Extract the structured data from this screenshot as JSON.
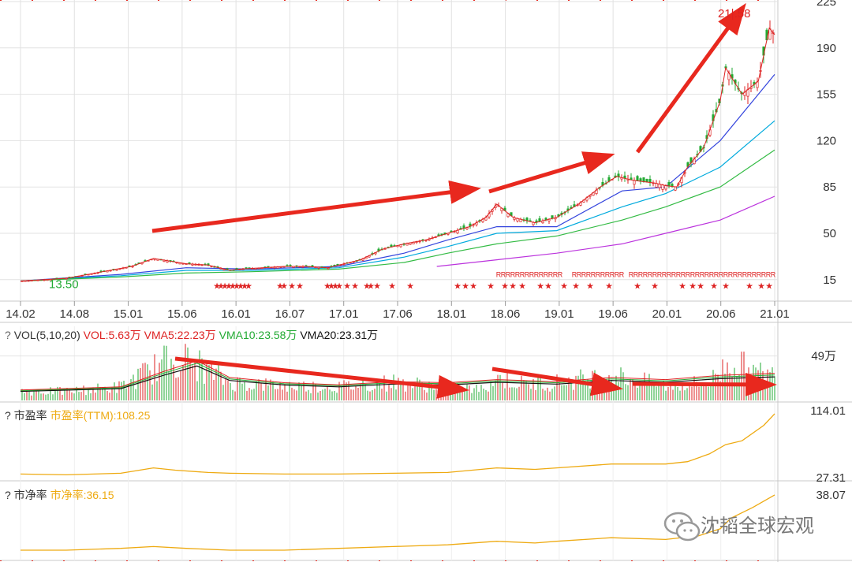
{
  "chart_data": [
    {
      "type": "candlestick",
      "panel": "price",
      "x_ticks": [
        "14.02",
        "14.08",
        "15.01",
        "15.06",
        "16.01",
        "16.07",
        "17.01",
        "17.06",
        "18.01",
        "18.06",
        "19.01",
        "19.06",
        "20.01",
        "20.06",
        "21.01"
      ],
      "y_ticks": [
        15,
        50,
        85,
        120,
        155,
        190,
        225
      ],
      "ylim": [
        0,
        225
      ],
      "annotations": {
        "low_label": "13.50",
        "high_label": "21|.58"
      },
      "close_series": {
        "x": [
          2014.08,
          2014.3,
          2014.5,
          2014.7,
          2014.9,
          2015.1,
          2015.3,
          2015.45,
          2015.6,
          2015.8,
          2016.0,
          2016.1,
          2016.3,
          2016.5,
          2016.7,
          2016.9,
          2017.0,
          2017.2,
          2017.4,
          2017.6,
          2017.8,
          2018.0,
          2018.2,
          2018.35,
          2018.45,
          2018.6,
          2018.8,
          2019.0,
          2019.2,
          2019.4,
          2019.55,
          2019.7,
          2019.9,
          2020.0,
          2020.1,
          2020.2,
          2020.35,
          2020.5,
          2020.55,
          2020.7,
          2020.85,
          2020.95,
          2021.0
        ],
        "y": [
          14,
          15,
          16,
          19,
          22,
          25,
          31,
          29,
          27,
          26,
          22,
          23,
          24,
          25,
          25,
          24,
          26,
          30,
          38,
          42,
          45,
          50,
          55,
          62,
          72,
          62,
          58,
          62,
          72,
          85,
          93,
          90,
          88,
          86,
          85,
          100,
          115,
          150,
          175,
          155,
          165,
          205,
          200
        ]
      },
      "moving_averages": [
        {
          "color": "#3344dd",
          "x": [
            2014.08,
            2015.0,
            2015.6,
            2016.2,
            2017.0,
            2017.6,
            2018.0,
            2018.45,
            2019.0,
            2019.6,
            2020.0,
            2020.5,
            2021.0
          ],
          "y": [
            14,
            19,
            24,
            23,
            25,
            35,
            45,
            55,
            55,
            82,
            85,
            120,
            170
          ]
        },
        {
          "color": "#00aadd",
          "x": [
            2014.08,
            2015.0,
            2015.6,
            2016.2,
            2017.0,
            2017.6,
            2018.0,
            2018.45,
            2019.0,
            2019.6,
            2020.0,
            2020.5,
            2021.0
          ],
          "y": [
            14,
            18,
            22,
            22,
            24,
            32,
            40,
            50,
            52,
            70,
            80,
            100,
            135
          ]
        },
        {
          "color": "#33bb44",
          "x": [
            2014.08,
            2015.0,
            2015.6,
            2016.2,
            2017.0,
            2017.6,
            2018.0,
            2018.45,
            2019.0,
            2019.6,
            2020.0,
            2020.5,
            2021.0
          ],
          "y": [
            14,
            17,
            20,
            21,
            23,
            28,
            35,
            42,
            48,
            60,
            70,
            85,
            113
          ]
        },
        {
          "color": "#bb33dd",
          "x": [
            2017.9,
            2018.45,
            2019.0,
            2019.6,
            2020.0,
            2020.5,
            2021.0
          ],
          "y": [
            25,
            30,
            35,
            42,
            50,
            60,
            78
          ]
        }
      ],
      "signal_rows": {
        "star_color": "#dd2222",
        "star_rows_y": 8,
        "r_marks_y": 17
      }
    },
    {
      "type": "bar",
      "panel": "volume",
      "header_prefix": "?",
      "legend": [
        {
          "text": "VOL(5,10,20)",
          "color": "#333333"
        },
        {
          "text": "VOL:5.63万",
          "color": "#dd2222"
        },
        {
          "text": "VMA5:22.23万",
          "color": "#dd2222"
        },
        {
          "text": "VMA10:23.58万",
          "color": "#22aa33"
        },
        {
          "text": "VMA20:23.31万",
          "color": "#111111"
        }
      ],
      "y_tick": "49万",
      "y_tick_value": 49,
      "ylim": [
        0,
        80
      ],
      "volume_series": {
        "x": [
          2014.08,
          2014.5,
          2015.0,
          2015.3,
          2015.5,
          2015.7,
          2016.0,
          2016.5,
          2017.0,
          2017.5,
          2018.0,
          2018.3,
          2018.45,
          2018.7,
          2019.0,
          2019.5,
          2020.0,
          2020.4,
          2020.6,
          2020.8,
          2021.0
        ],
        "y": [
          10,
          10,
          15,
          35,
          48,
          40,
          20,
          16,
          15,
          20,
          15,
          12,
          25,
          18,
          20,
          28,
          16,
          20,
          45,
          30,
          28
        ]
      },
      "vma20_series": {
        "x": [
          2014.08,
          2015.0,
          2015.4,
          2015.7,
          2016.0,
          2016.5,
          2017.0,
          2017.5,
          2018.0,
          2018.45,
          2019.0,
          2019.5,
          2020.0,
          2020.5,
          2021.0
        ],
        "y": [
          10,
          13,
          28,
          38,
          22,
          17,
          15,
          18,
          17,
          20,
          18,
          22,
          20,
          24,
          26
        ]
      }
    },
    {
      "type": "line",
      "panel": "pe",
      "header_prefix": "?",
      "label": "市盈率",
      "series_label": "市盈率(TTM):108.25",
      "color": "#eeaa11",
      "y_ticks": [
        "114.01",
        "27.31"
      ],
      "ylim": [
        27.31,
        114.01
      ],
      "x": [
        2014.08,
        2014.5,
        2015.0,
        2015.3,
        2015.5,
        2015.8,
        2016.0,
        2016.5,
        2017.0,
        2017.5,
        2018.0,
        2018.45,
        2018.8,
        2019.0,
        2019.5,
        2020.0,
        2020.2,
        2020.4,
        2020.55,
        2020.7,
        2020.9,
        2021.0
      ],
      "y": [
        32,
        31,
        33,
        40,
        37,
        34,
        33,
        32,
        32,
        33,
        34,
        40,
        38,
        40,
        45,
        45,
        48,
        58,
        70,
        75,
        95,
        110
      ]
    },
    {
      "type": "line",
      "panel": "pb",
      "header_prefix": "?",
      "label": "市净率",
      "series_label": "市净率:36.15",
      "color": "#eeaa11",
      "y_ticks": [
        "38.07"
      ],
      "ylim": [
        0,
        38.07
      ],
      "x": [
        2014.08,
        2014.5,
        2015.0,
        2015.3,
        2015.6,
        2016.0,
        2016.5,
        2017.0,
        2017.5,
        2018.0,
        2018.45,
        2018.8,
        2019.0,
        2019.5,
        2020.0,
        2020.3,
        2020.5,
        2020.6,
        2020.8,
        2021.0
      ],
      "y": [
        4,
        4,
        5,
        6,
        5,
        4,
        4,
        5,
        6,
        7,
        9,
        8,
        9,
        11,
        10,
        12,
        16,
        22,
        28,
        35
      ]
    }
  ],
  "watermark": "沈韬全球宏观",
  "watermark_icon": "wechat-icon"
}
